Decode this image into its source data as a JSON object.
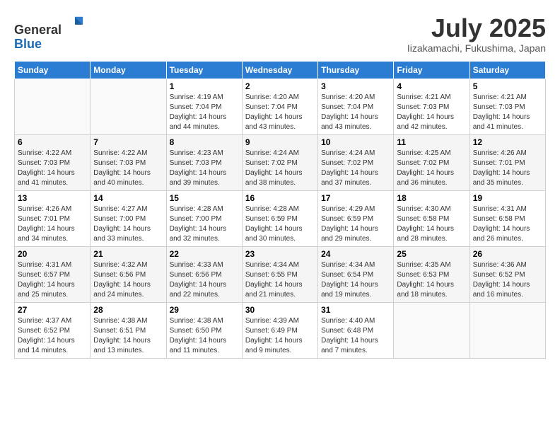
{
  "header": {
    "logo_line1": "General",
    "logo_line2": "Blue",
    "month_title": "July 2025",
    "location": "Iizakamachi, Fukushima, Japan"
  },
  "weekdays": [
    "Sunday",
    "Monday",
    "Tuesday",
    "Wednesday",
    "Thursday",
    "Friday",
    "Saturday"
  ],
  "weeks": [
    [
      {
        "day": "",
        "info": ""
      },
      {
        "day": "",
        "info": ""
      },
      {
        "day": "1",
        "info": "Sunrise: 4:19 AM\nSunset: 7:04 PM\nDaylight: 14 hours\nand 44 minutes."
      },
      {
        "day": "2",
        "info": "Sunrise: 4:20 AM\nSunset: 7:04 PM\nDaylight: 14 hours\nand 43 minutes."
      },
      {
        "day": "3",
        "info": "Sunrise: 4:20 AM\nSunset: 7:04 PM\nDaylight: 14 hours\nand 43 minutes."
      },
      {
        "day": "4",
        "info": "Sunrise: 4:21 AM\nSunset: 7:03 PM\nDaylight: 14 hours\nand 42 minutes."
      },
      {
        "day": "5",
        "info": "Sunrise: 4:21 AM\nSunset: 7:03 PM\nDaylight: 14 hours\nand 41 minutes."
      }
    ],
    [
      {
        "day": "6",
        "info": "Sunrise: 4:22 AM\nSunset: 7:03 PM\nDaylight: 14 hours\nand 41 minutes."
      },
      {
        "day": "7",
        "info": "Sunrise: 4:22 AM\nSunset: 7:03 PM\nDaylight: 14 hours\nand 40 minutes."
      },
      {
        "day": "8",
        "info": "Sunrise: 4:23 AM\nSunset: 7:03 PM\nDaylight: 14 hours\nand 39 minutes."
      },
      {
        "day": "9",
        "info": "Sunrise: 4:24 AM\nSunset: 7:02 PM\nDaylight: 14 hours\nand 38 minutes."
      },
      {
        "day": "10",
        "info": "Sunrise: 4:24 AM\nSunset: 7:02 PM\nDaylight: 14 hours\nand 37 minutes."
      },
      {
        "day": "11",
        "info": "Sunrise: 4:25 AM\nSunset: 7:02 PM\nDaylight: 14 hours\nand 36 minutes."
      },
      {
        "day": "12",
        "info": "Sunrise: 4:26 AM\nSunset: 7:01 PM\nDaylight: 14 hours\nand 35 minutes."
      }
    ],
    [
      {
        "day": "13",
        "info": "Sunrise: 4:26 AM\nSunset: 7:01 PM\nDaylight: 14 hours\nand 34 minutes."
      },
      {
        "day": "14",
        "info": "Sunrise: 4:27 AM\nSunset: 7:00 PM\nDaylight: 14 hours\nand 33 minutes."
      },
      {
        "day": "15",
        "info": "Sunrise: 4:28 AM\nSunset: 7:00 PM\nDaylight: 14 hours\nand 32 minutes."
      },
      {
        "day": "16",
        "info": "Sunrise: 4:28 AM\nSunset: 6:59 PM\nDaylight: 14 hours\nand 30 minutes."
      },
      {
        "day": "17",
        "info": "Sunrise: 4:29 AM\nSunset: 6:59 PM\nDaylight: 14 hours\nand 29 minutes."
      },
      {
        "day": "18",
        "info": "Sunrise: 4:30 AM\nSunset: 6:58 PM\nDaylight: 14 hours\nand 28 minutes."
      },
      {
        "day": "19",
        "info": "Sunrise: 4:31 AM\nSunset: 6:58 PM\nDaylight: 14 hours\nand 26 minutes."
      }
    ],
    [
      {
        "day": "20",
        "info": "Sunrise: 4:31 AM\nSunset: 6:57 PM\nDaylight: 14 hours\nand 25 minutes."
      },
      {
        "day": "21",
        "info": "Sunrise: 4:32 AM\nSunset: 6:56 PM\nDaylight: 14 hours\nand 24 minutes."
      },
      {
        "day": "22",
        "info": "Sunrise: 4:33 AM\nSunset: 6:56 PM\nDaylight: 14 hours\nand 22 minutes."
      },
      {
        "day": "23",
        "info": "Sunrise: 4:34 AM\nSunset: 6:55 PM\nDaylight: 14 hours\nand 21 minutes."
      },
      {
        "day": "24",
        "info": "Sunrise: 4:34 AM\nSunset: 6:54 PM\nDaylight: 14 hours\nand 19 minutes."
      },
      {
        "day": "25",
        "info": "Sunrise: 4:35 AM\nSunset: 6:53 PM\nDaylight: 14 hours\nand 18 minutes."
      },
      {
        "day": "26",
        "info": "Sunrise: 4:36 AM\nSunset: 6:52 PM\nDaylight: 14 hours\nand 16 minutes."
      }
    ],
    [
      {
        "day": "27",
        "info": "Sunrise: 4:37 AM\nSunset: 6:52 PM\nDaylight: 14 hours\nand 14 minutes."
      },
      {
        "day": "28",
        "info": "Sunrise: 4:38 AM\nSunset: 6:51 PM\nDaylight: 14 hours\nand 13 minutes."
      },
      {
        "day": "29",
        "info": "Sunrise: 4:38 AM\nSunset: 6:50 PM\nDaylight: 14 hours\nand 11 minutes."
      },
      {
        "day": "30",
        "info": "Sunrise: 4:39 AM\nSunset: 6:49 PM\nDaylight: 14 hours\nand 9 minutes."
      },
      {
        "day": "31",
        "info": "Sunrise: 4:40 AM\nSunset: 6:48 PM\nDaylight: 14 hours\nand 7 minutes."
      },
      {
        "day": "",
        "info": ""
      },
      {
        "day": "",
        "info": ""
      }
    ]
  ]
}
